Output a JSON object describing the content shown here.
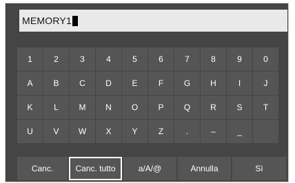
{
  "input": {
    "value": "MEMORY1"
  },
  "keyboard": {
    "rows": [
      [
        "1",
        "2",
        "3",
        "4",
        "5",
        "6",
        "7",
        "8",
        "9",
        "0"
      ],
      [
        "A",
        "B",
        "C",
        "D",
        "E",
        "F",
        "G",
        "H",
        "I",
        "J"
      ],
      [
        "K",
        "L",
        "M",
        "N",
        "O",
        "P",
        "Q",
        "R",
        "S",
        "T"
      ],
      [
        "U",
        "V",
        "W",
        "X",
        "Y",
        "Z",
        ".",
        "–",
        "_",
        ""
      ]
    ]
  },
  "buttons": {
    "delete": "Canc.",
    "delete_all": "Canc. tutto",
    "case_toggle": "a/A/@",
    "cancel": "Annulla",
    "confirm": "Sì"
  },
  "colors": {
    "panel_bg": "#454545",
    "key_bg": "#555555",
    "input_bg": "#e9e9e9",
    "key_text": "#ffffff",
    "selection_outline": "#ffffff"
  }
}
